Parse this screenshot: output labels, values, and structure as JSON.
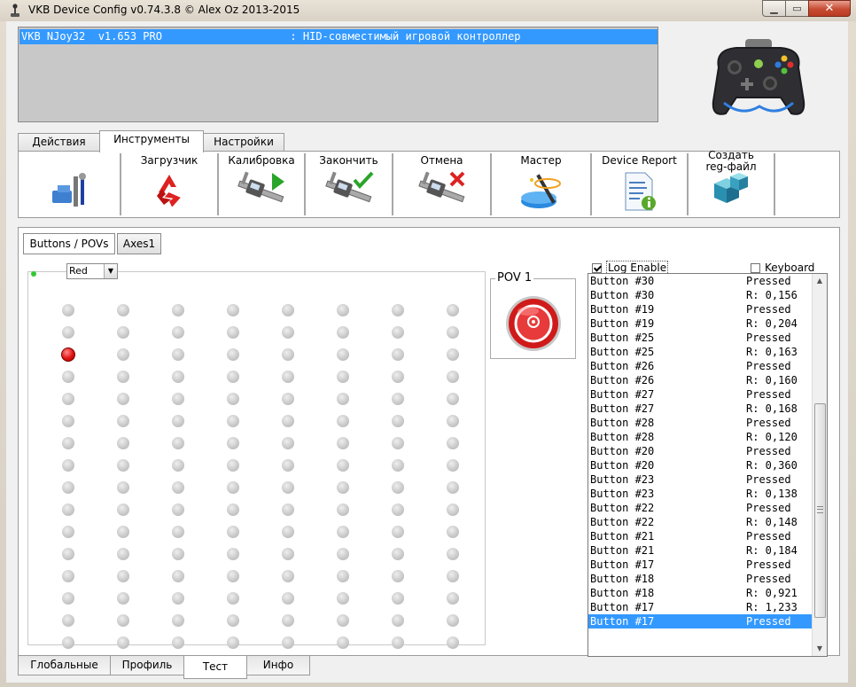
{
  "window": {
    "title": "VKB Device Config v0.74.3.8 © Alex Oz 2013-2015",
    "icons": {
      "app": "joystick-icon",
      "minimize": "minimize-icon",
      "maximize": "maximize-icon",
      "close": "close-icon"
    }
  },
  "device_list": {
    "rows": [
      {
        "text": "VKB NJoy32  v1.653 PRO                    : HID-совместимый игровой контроллер"
      }
    ],
    "icon": "gamepad-icon"
  },
  "top_tabs": [
    {
      "label": "Действия"
    },
    {
      "label": "Инструменты",
      "active": true
    },
    {
      "label": "Настройки"
    }
  ],
  "toolbar": {
    "items": [
      {
        "label": "",
        "icon": "tools-icon"
      },
      {
        "label": "Загрузчик",
        "icon": "recycle-icon"
      },
      {
        "label": "Калибровка",
        "icon": "caliper-play-icon"
      },
      {
        "label": "Закончить",
        "icon": "caliper-check-icon"
      },
      {
        "label": "Отмена",
        "icon": "caliper-cancel-icon"
      },
      {
        "label": "Мастер",
        "icon": "wizard-icon"
      },
      {
        "label": "Device Report",
        "icon": "report-icon"
      },
      {
        "label": "Создать\nreg-файл",
        "icon": "registry-icon"
      }
    ]
  },
  "sub_tabs": [
    {
      "label": "Buttons / POVs",
      "active": true
    },
    {
      "label": "Axes1"
    }
  ],
  "buttons_grid": {
    "color_select": "Red",
    "columns": 8,
    "rows": 16,
    "pressed": [
      {
        "col": 0,
        "row": 2
      }
    ]
  },
  "pov": {
    "label": "POV 1",
    "icon": "pov-hat-icon"
  },
  "log": {
    "enable_label": "Log Enable",
    "enabled": true,
    "keyboard_label": "Keyboard",
    "keyboard": false,
    "entries": [
      [
        "Button #30",
        "Pressed"
      ],
      [
        "Button #30",
        "R: 0,156"
      ],
      [
        "Button #19",
        "Pressed"
      ],
      [
        "Button #19",
        "R: 0,204"
      ],
      [
        "Button #25",
        "Pressed"
      ],
      [
        "Button #25",
        "R: 0,163"
      ],
      [
        "Button #26",
        "Pressed"
      ],
      [
        "Button #26",
        "R: 0,160"
      ],
      [
        "Button #27",
        "Pressed"
      ],
      [
        "Button #27",
        "R: 0,168"
      ],
      [
        "Button #28",
        "Pressed"
      ],
      [
        "Button #28",
        "R: 0,120"
      ],
      [
        "Button #20",
        "Pressed"
      ],
      [
        "Button #20",
        "R: 0,360"
      ],
      [
        "Button #23",
        "Pressed"
      ],
      [
        "Button #23",
        "R: 0,138"
      ],
      [
        "Button #22",
        "Pressed"
      ],
      [
        "Button #22",
        "R: 0,148"
      ],
      [
        "Button #21",
        "Pressed"
      ],
      [
        "Button #21",
        "R: 0,184"
      ],
      [
        "Button #17",
        "Pressed"
      ],
      [
        "Button #18",
        "Pressed"
      ],
      [
        "Button #18",
        "R: 0,921"
      ],
      [
        "Button #17",
        "R: 1,233"
      ],
      [
        "Button #17",
        "Pressed"
      ]
    ],
    "selected_index": 24
  },
  "bottom_tabs": [
    {
      "label": "Глобальные"
    },
    {
      "label": "Профиль"
    },
    {
      "label": "Тест",
      "active": true
    },
    {
      "label": "Инфо"
    }
  ],
  "colors": {
    "selection": "#3399ff",
    "pressed": "#e01010",
    "indicator": "#32c832"
  }
}
